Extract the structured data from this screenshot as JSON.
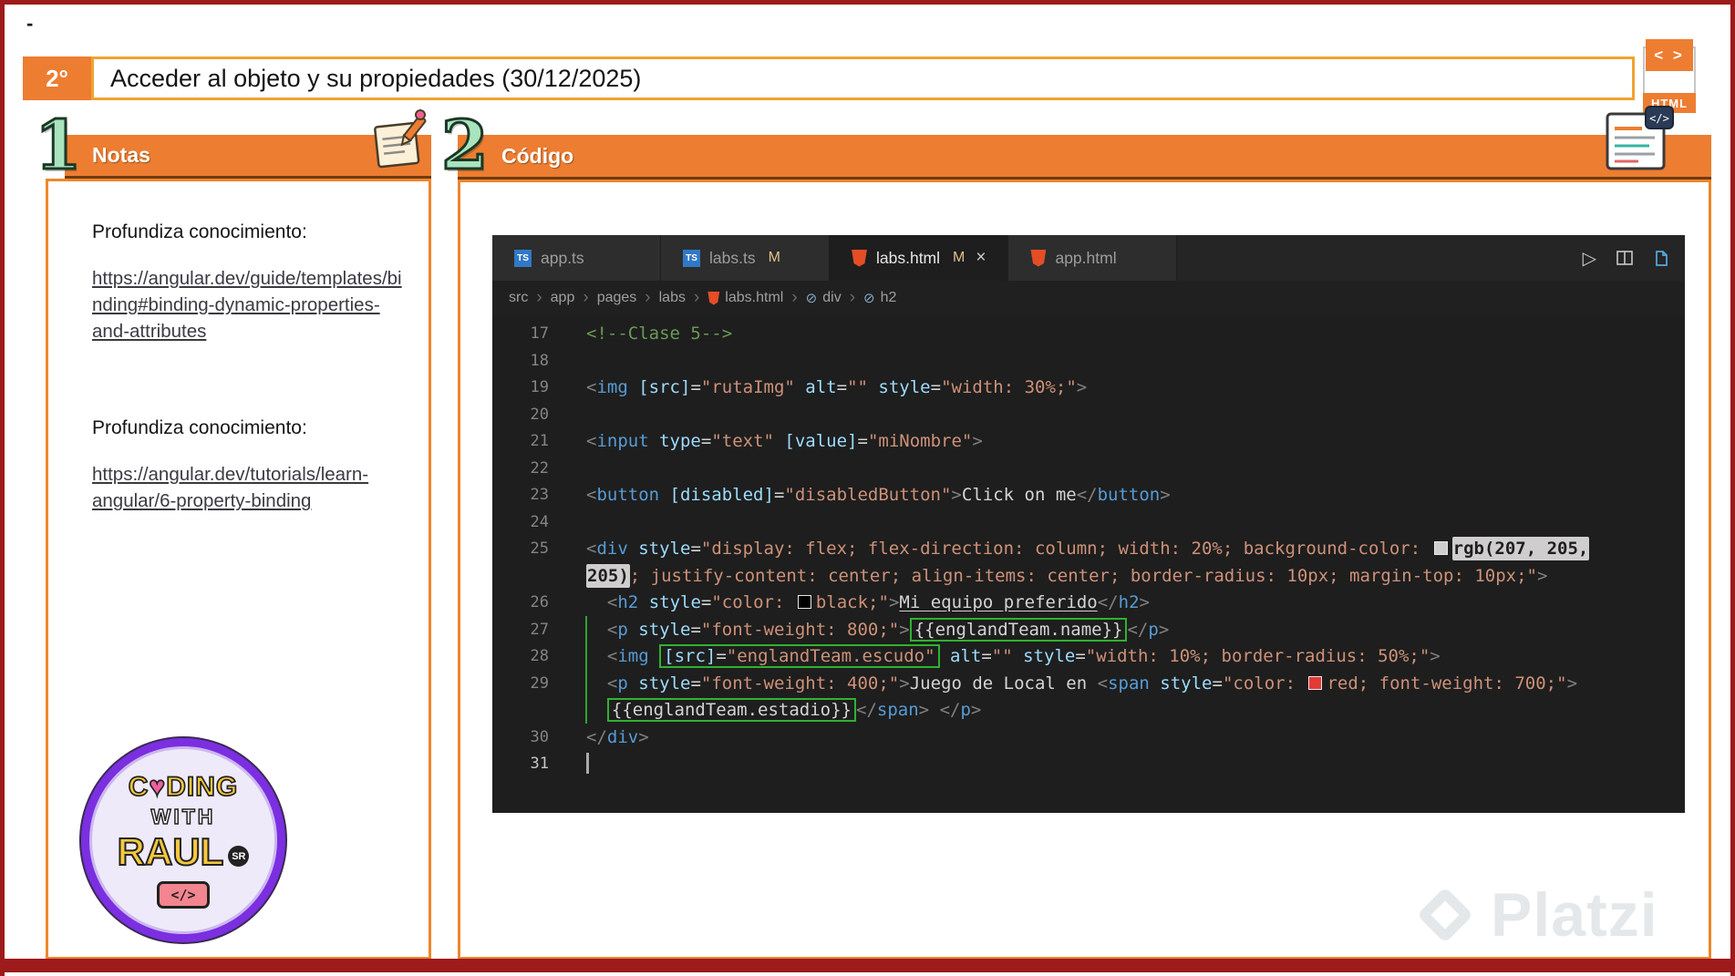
{
  "frame": {
    "dash": "-"
  },
  "title_bar": {
    "badge": "2°",
    "title": "Acceder al objeto y su propiedades (30/12/2025)"
  },
  "html_icon": {
    "glyph": "< >",
    "label": "HTML"
  },
  "notes": {
    "number": "1",
    "header": "Notas",
    "heading1": "Profundiza conocimiento:",
    "link1": "https://angular.dev/guide/templates/binding#binding-dynamic-properties-and-attributes",
    "heading2": "Profundiza conocimiento:",
    "link2": "https://angular.dev/tutorials/learn-angular/6-property-binding"
  },
  "logo": {
    "c1": "C",
    "heart": "♥",
    "c2": "DING",
    "with": "WITH",
    "raul": "RAUL",
    "sr": "SR",
    "code_glyph": "</>"
  },
  "code_section": {
    "number": "2",
    "header": "Código"
  },
  "editor": {
    "tabs": [
      {
        "name": "app.ts",
        "icon": "ts",
        "active": false,
        "badge": "",
        "close": ""
      },
      {
        "name": "labs.ts",
        "icon": "ts",
        "active": false,
        "badge": "M",
        "close": ""
      },
      {
        "name": "labs.html",
        "icon": "html",
        "active": true,
        "badge": "M",
        "close": "×"
      },
      {
        "name": "app.html",
        "icon": "html",
        "active": false,
        "badge": "",
        "close": ""
      }
    ],
    "breadcrumb": [
      {
        "label": "src",
        "icon": ""
      },
      {
        "label": "app",
        "icon": ""
      },
      {
        "label": "pages",
        "icon": ""
      },
      {
        "label": "labs",
        "icon": ""
      },
      {
        "label": "labs.html",
        "icon": "html"
      },
      {
        "label": "div",
        "icon": "symbol"
      },
      {
        "label": "h2",
        "icon": "symbol"
      }
    ],
    "lines": [
      {
        "n": "17",
        "segs": [
          [
            "c",
            "<!--Clase 5-->"
          ]
        ]
      },
      {
        "n": "18",
        "segs": []
      },
      {
        "n": "19",
        "segs": [
          [
            "p",
            "<"
          ],
          [
            "t",
            "img"
          ],
          [
            "w",
            " "
          ],
          [
            "a",
            "[src]"
          ],
          [
            "w",
            "="
          ],
          [
            "s",
            "\"rutaImg\""
          ],
          [
            "w",
            " "
          ],
          [
            "a",
            "alt"
          ],
          [
            "w",
            "="
          ],
          [
            "s",
            "\"\""
          ],
          [
            "w",
            " "
          ],
          [
            "a",
            "style"
          ],
          [
            "w",
            "="
          ],
          [
            "s",
            "\"width: 30%;\""
          ],
          [
            "p",
            ">"
          ]
        ]
      },
      {
        "n": "20",
        "segs": []
      },
      {
        "n": "21",
        "segs": [
          [
            "p",
            "<"
          ],
          [
            "t",
            "input"
          ],
          [
            "w",
            " "
          ],
          [
            "a",
            "type"
          ],
          [
            "w",
            "="
          ],
          [
            "s",
            "\"text\""
          ],
          [
            "w",
            " "
          ],
          [
            "a",
            "[value]"
          ],
          [
            "w",
            "="
          ],
          [
            "s",
            "\"miNombre\""
          ],
          [
            "p",
            ">"
          ]
        ]
      },
      {
        "n": "22",
        "segs": []
      },
      {
        "n": "23",
        "segs": [
          [
            "p",
            "<"
          ],
          [
            "t",
            "button"
          ],
          [
            "w",
            " "
          ],
          [
            "a",
            "[disabled]"
          ],
          [
            "w",
            "="
          ],
          [
            "s",
            "\"disabledButton\""
          ],
          [
            "p",
            ">"
          ],
          [
            "w",
            "Click on me"
          ],
          [
            "p",
            "</"
          ],
          [
            "t",
            "button"
          ],
          [
            "p",
            ">"
          ]
        ]
      },
      {
        "n": "24",
        "segs": []
      },
      {
        "n": "25",
        "segs": [
          [
            "p",
            "<"
          ],
          [
            "t",
            "div"
          ],
          [
            "w",
            " "
          ],
          [
            "a",
            "style"
          ],
          [
            "w",
            "="
          ],
          [
            "s",
            "\"display: flex; flex-direction: column; width: 20%; background-color: "
          ],
          [
            "sw swW",
            ""
          ],
          [
            "hl",
            "rgb(207, 205,"
          ]
        ]
      },
      {
        "n": "",
        "segs": [
          [
            "hl",
            "205)"
          ],
          [
            "s",
            "; justify-content: center; align-items: center; border-radius: 10px; margin-top: 10px;\""
          ],
          [
            "p",
            ">"
          ]
        ]
      },
      {
        "n": "26",
        "segs": [
          [
            "w",
            "  "
          ],
          [
            "p",
            "<"
          ],
          [
            "t",
            "h2"
          ],
          [
            "w",
            " "
          ],
          [
            "a",
            "style"
          ],
          [
            "w",
            "="
          ],
          [
            "s",
            "\"color: "
          ],
          [
            "sw swB",
            ""
          ],
          [
            "s",
            "black;\""
          ],
          [
            "p",
            ">"
          ],
          [
            "w u",
            "Mi equipo preferido"
          ],
          [
            "p",
            "</"
          ],
          [
            "t",
            "h2"
          ],
          [
            "p",
            ">"
          ]
        ]
      },
      {
        "n": "27",
        "segs": [
          [
            "w",
            "  "
          ],
          [
            "p",
            "<"
          ],
          [
            "t",
            "p"
          ],
          [
            "w",
            " "
          ],
          [
            "a",
            "style"
          ],
          [
            "w",
            "="
          ],
          [
            "s",
            "\"font-weight: 800;\""
          ],
          [
            "p",
            ">"
          ],
          [
            "w bx bxl bxr",
            "{{englandTeam.name}}"
          ],
          [
            "p",
            "</"
          ],
          [
            "t",
            "p"
          ],
          [
            "p",
            ">"
          ]
        ]
      },
      {
        "n": "28",
        "segs": [
          [
            "w",
            "  "
          ],
          [
            "p",
            "<"
          ],
          [
            "t",
            "img"
          ],
          [
            "w",
            " "
          ],
          [
            "a bx bxl",
            "[src]"
          ],
          [
            "w bx",
            "="
          ],
          [
            "s bx bxr",
            "\"englandTeam.escudo\""
          ],
          [
            "w",
            " "
          ],
          [
            "a",
            "alt"
          ],
          [
            "w",
            "="
          ],
          [
            "s",
            "\"\""
          ],
          [
            "w",
            " "
          ],
          [
            "a",
            "style"
          ],
          [
            "w",
            "="
          ],
          [
            "s",
            "\"width: 10%; border-radius: 50%;\""
          ],
          [
            "p",
            ">"
          ]
        ]
      },
      {
        "n": "29",
        "segs": [
          [
            "w",
            "  "
          ],
          [
            "p",
            "<"
          ],
          [
            "t",
            "p"
          ],
          [
            "w",
            " "
          ],
          [
            "a",
            "style"
          ],
          [
            "w",
            "="
          ],
          [
            "s",
            "\"font-weight: 400;\""
          ],
          [
            "p",
            ">"
          ],
          [
            "w",
            "Juego de Local en "
          ],
          [
            "p",
            "<"
          ],
          [
            "t",
            "span"
          ],
          [
            "w",
            " "
          ],
          [
            "a",
            "style"
          ],
          [
            "w",
            "="
          ],
          [
            "s",
            "\"color: "
          ],
          [
            "sw swR",
            ""
          ],
          [
            "s",
            "red; font-weight: 700;\""
          ],
          [
            "p",
            ">"
          ]
        ]
      },
      {
        "n": "",
        "segs": [
          [
            "w",
            "  "
          ],
          [
            "w bx bxl bxr",
            "{{englandTeam.estadio}}"
          ],
          [
            "p",
            "</"
          ],
          [
            "t",
            "span"
          ],
          [
            "p",
            ">"
          ],
          [
            "w",
            " "
          ],
          [
            "p",
            "</"
          ],
          [
            "t",
            "p"
          ],
          [
            "p",
            ">"
          ]
        ]
      },
      {
        "n": "30",
        "segs": [
          [
            "p",
            "</"
          ],
          [
            "t",
            "div"
          ],
          [
            "p",
            ">"
          ]
        ]
      },
      {
        "n": "31",
        "cur": true,
        "cursor": true,
        "segs": []
      }
    ]
  },
  "watermark": {
    "text": "Platzi"
  }
}
